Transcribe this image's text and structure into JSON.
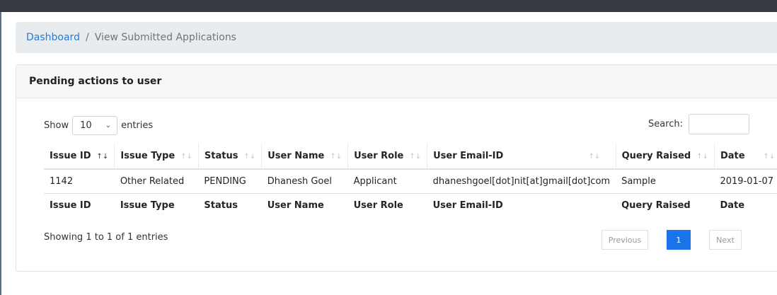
{
  "breadcrumb": {
    "home": "Dashboard",
    "separator": "/",
    "current": "View Submitted Applications"
  },
  "card": {
    "title": "Pending actions to user"
  },
  "controls": {
    "show_label": "Show",
    "page_size": "10",
    "entries_label": "entries",
    "search_label": "Search:",
    "search_value": ""
  },
  "table": {
    "headers": [
      "Issue ID",
      "Issue Type",
      "Status",
      "User Name",
      "User Role",
      "User Email-ID",
      "Query Raised",
      "Date"
    ],
    "rows": [
      [
        "1142",
        "Other Related",
        "PENDING",
        "Dhanesh Goel",
        "Applicant",
        "dhaneshgoel[dot]nit[at]gmail[dot]com",
        "Sample",
        "2019-01-07"
      ]
    ],
    "footers": [
      "Issue ID",
      "Issue Type",
      "Status",
      "User Name",
      "User Role",
      "User Email-ID",
      "Query Raised",
      "Date"
    ]
  },
  "info": "Showing 1 to 1 of 1 entries",
  "pagination": {
    "previous": "Previous",
    "current": "1",
    "next": "Next"
  },
  "colors": {
    "link": "#2a7bd4",
    "active_page": "#1a73e8",
    "topbar": "#343a40"
  }
}
